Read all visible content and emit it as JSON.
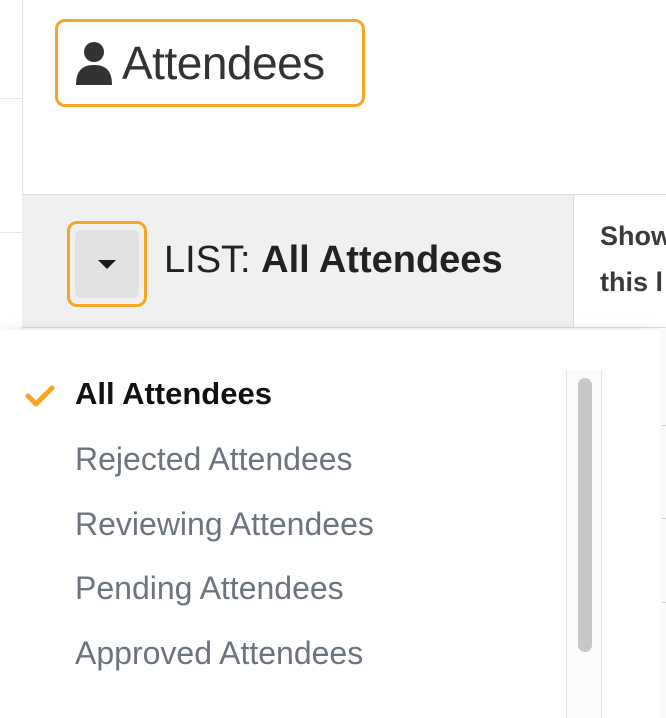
{
  "header": {
    "title": "Attendees",
    "icon": "user-icon"
  },
  "list_bar": {
    "prefix": "LIST: ",
    "current_list": "All Attendees",
    "dropdown_icon": "caret-down-icon",
    "side_text_line1": "Show",
    "side_text_line2": "this l"
  },
  "dropdown": {
    "items": [
      {
        "label": "All Attendees",
        "selected": true
      },
      {
        "label": "Rejected Attendees",
        "selected": false
      },
      {
        "label": "Reviewing Attendees",
        "selected": false
      },
      {
        "label": "Pending Attendees",
        "selected": false
      },
      {
        "label": "Approved Attendees",
        "selected": false
      }
    ],
    "selected_icon": "checkmark-icon",
    "accent_color": "#f5a623"
  },
  "colors": {
    "highlight": "#f5a623",
    "bar_background": "#f0f0f0",
    "item_text": "#6c7480"
  }
}
